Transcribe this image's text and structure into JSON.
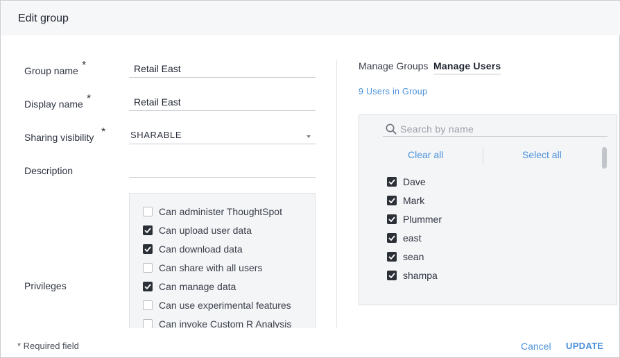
{
  "dialog": {
    "title": "Edit group"
  },
  "form": {
    "group_name": {
      "label": "Group name",
      "required_mark": "*",
      "value": "Retail East"
    },
    "display_name": {
      "label": "Display name",
      "required_mark": "*",
      "value": "Retail East"
    },
    "sharing_visibility": {
      "label": "Sharing visibility",
      "required_mark": "*",
      "value": "SHARABLE"
    },
    "description": {
      "label": "Description",
      "value": ""
    },
    "privileges": {
      "label": "Privileges",
      "items": [
        {
          "label": "Can administer ThoughtSpot",
          "checked": false
        },
        {
          "label": "Can upload user data",
          "checked": true
        },
        {
          "label": "Can download data",
          "checked": true
        },
        {
          "label": "Can share with all users",
          "checked": false
        },
        {
          "label": "Can manage data",
          "checked": true
        },
        {
          "label": "Can use experimental features",
          "checked": false
        },
        {
          "label": "Can invoke Custom R Analysis",
          "checked": false
        }
      ]
    }
  },
  "tabs": [
    {
      "label": "Manage Groups",
      "active": false
    },
    {
      "label": "Manage Users",
      "active": true
    }
  ],
  "users_panel": {
    "count_text": "9 Users in Group",
    "search_placeholder": "Search by name",
    "clear_all": "Clear all",
    "select_all": "Select all",
    "users": [
      {
        "name": "Dave",
        "checked": true
      },
      {
        "name": "Mark",
        "checked": true
      },
      {
        "name": "Plummer",
        "checked": true
      },
      {
        "name": "east",
        "checked": true
      },
      {
        "name": "sean",
        "checked": true
      },
      {
        "name": "shampa",
        "checked": true
      }
    ]
  },
  "footer": {
    "required_note": "* Required field",
    "cancel": "Cancel",
    "update": "UPDATE"
  },
  "colors": {
    "accent": "#4a90d9",
    "checkbox_checked": "#2b2f36",
    "panel_bg": "#f4f5f7",
    "header_bg": "#f6f7f9"
  },
  "icons": {
    "search": "search-icon",
    "dropdown": "chevron-down-icon",
    "check": "check-icon"
  }
}
